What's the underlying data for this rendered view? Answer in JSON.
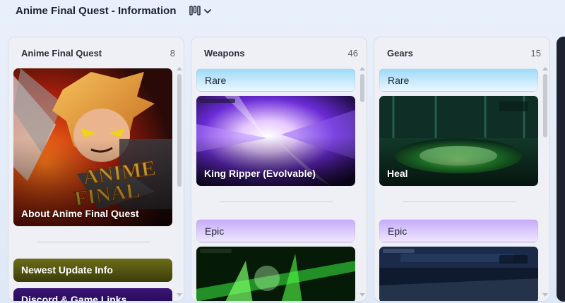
{
  "header": {
    "title": "Anime Final Quest - Information",
    "view_icon": "board-view-icon",
    "chevron_icon": "chevron-down-icon"
  },
  "columns": [
    {
      "name": "Anime Final Quest",
      "count": "8",
      "cards": [
        {
          "label": "About Anime Final Quest",
          "image_logo_text": "ANIME FINAL"
        }
      ],
      "links": [
        {
          "label": "Newest Update Info",
          "color": "#5a5a12"
        },
        {
          "label": "Discord & Game Links",
          "color": "#2b0f5c"
        }
      ]
    },
    {
      "name": "Weapons",
      "count": "46",
      "groups": [
        {
          "label": "Rare",
          "color": "#bfe6fb"
        },
        {
          "label": "Epic",
          "color": "#d8c6fb"
        }
      ],
      "cards": [
        {
          "label": "King Ripper (Evolvable)"
        },
        {
          "label": ""
        }
      ]
    },
    {
      "name": "Gears",
      "count": "15",
      "groups": [
        {
          "label": "Rare",
          "color": "#bfe6fb"
        },
        {
          "label": "Epic",
          "color": "#d8c6fb"
        }
      ],
      "cards": [
        {
          "label": "Heal"
        },
        {
          "label": ""
        }
      ]
    }
  ],
  "colors": {
    "accent": "#1d2230",
    "rare": "#bfe6fb",
    "epic": "#d8c6fb"
  }
}
